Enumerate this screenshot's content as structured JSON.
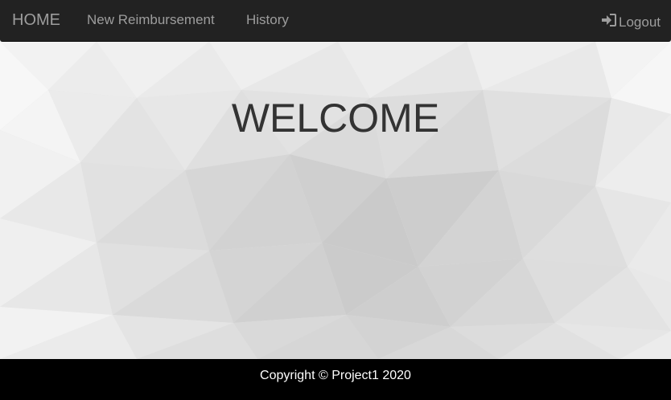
{
  "navbar": {
    "brand": "HOME",
    "links": [
      {
        "label": "New Reimbursement"
      },
      {
        "label": "History"
      }
    ],
    "logout_label": "Logout",
    "logout_icon": "sign-in-icon",
    "background": "#222222",
    "link_color": "#9d9d9d"
  },
  "main": {
    "heading": "WELCOME",
    "background_style": "low-poly gray"
  },
  "footer": {
    "text": "Copyright © Project1 2020",
    "background": "#000000"
  }
}
